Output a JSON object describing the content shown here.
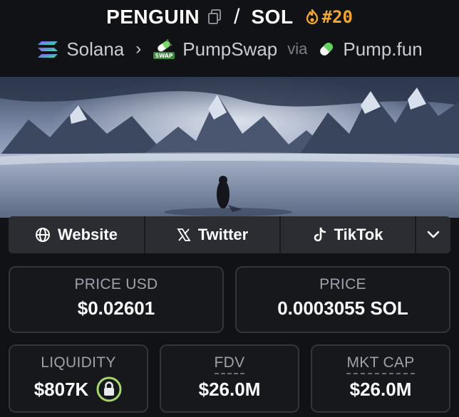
{
  "header": {
    "base_symbol": "PENGUIN",
    "separator": "/",
    "quote_symbol": "SOL",
    "rank": "#20",
    "chain": "Solana",
    "dex": "PumpSwap",
    "dex_badge": "SWAP",
    "via": "via",
    "launchpad": "Pump.fun"
  },
  "links": [
    {
      "label": "Website",
      "icon": "globe-icon"
    },
    {
      "label": "Twitter",
      "icon": "x-logo-icon"
    },
    {
      "label": "TikTok",
      "icon": "tiktok-icon"
    }
  ],
  "stats": {
    "price_usd": {
      "label": "PRICE USD",
      "value": "$0.02601"
    },
    "price": {
      "label": "PRICE",
      "value": "0.0003055 SOL"
    },
    "liquidity": {
      "label": "LIQUIDITY",
      "value": "$807K"
    },
    "fdv": {
      "label": "FDV",
      "value": "$26.0M"
    },
    "mkt_cap": {
      "label": "MKT CAP",
      "value": "$26.0M"
    }
  },
  "colors": {
    "accent_orange": "#f5a524",
    "lock_green": "#a8d86b",
    "background": "#111215"
  }
}
